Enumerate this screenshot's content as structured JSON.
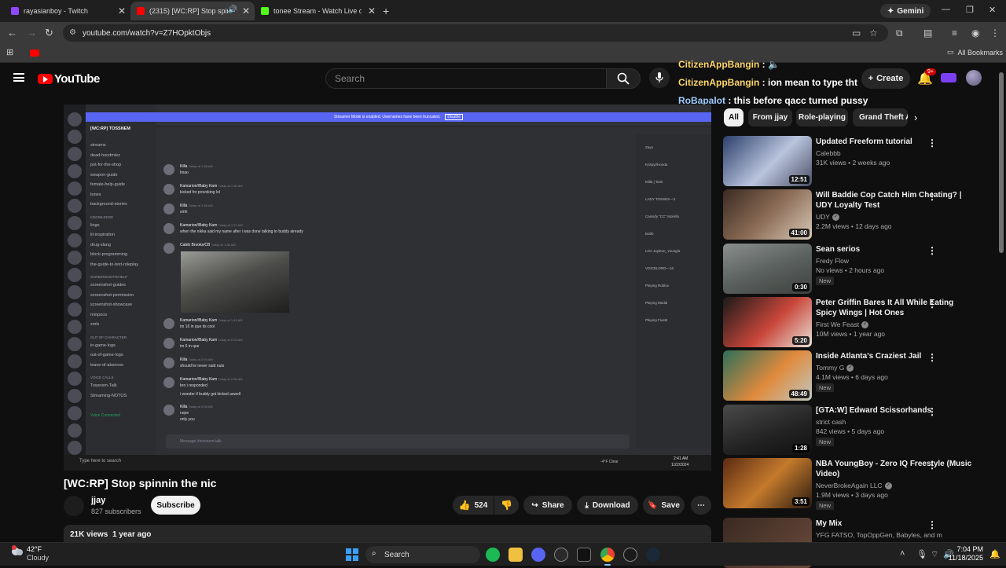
{
  "browser": {
    "tabs": [
      {
        "title": "rayasianboy - Twitch",
        "favicon_color": "#9146ff"
      },
      {
        "title": "(2315) [WC:RP] Stop spinnin",
        "favicon_color": "#ff0000"
      },
      {
        "title": "tonee Stream - Watch Live on K",
        "favicon_color": "#53fc18"
      }
    ],
    "gemini_label": "Gemini",
    "url": "youtube.com/watch?v=Z7HOpktObjs",
    "all_bookmarks": "All Bookmarks"
  },
  "youtube": {
    "logo_text": "YouTube",
    "search_placeholder": "Search",
    "create_label": "Create",
    "notif_count": "9+"
  },
  "chat_overlay": [
    {
      "name": "CitizenAppBangin",
      "text": "",
      "color": "#ffd76a"
    },
    {
      "name": "CitizenAppBangin",
      "text": "ion mean to type tht",
      "color": "#ffd76a"
    },
    {
      "name": "RoBapalot",
      "text": "this before qacc turned pussy",
      "color": "#9ecbff"
    }
  ],
  "video_content": {
    "banner": "Streamer Mode is enabled. Usernames have been truncated.",
    "banner_btn": "Disable",
    "server": "[WC:RP] TOSSNEM",
    "channel": "tossnem-talk",
    "channels_top": [
      "streams",
      "dead-hoodmiez",
      "pot-for-the-shop",
      "weapon-guide",
      "female-help-guide",
      "tones",
      "background-stories"
    ],
    "cat_knowledge": "KNOWLEDGE",
    "channels_knowledge": [
      "lingo",
      "lit-inspiration",
      "drug-slang",
      "block-programming",
      "the-guide-to-text-roleplay"
    ],
    "cat_screenshots": "SCREENSHOTS/HELP",
    "channels_screenshots": [
      "screenshot-guides",
      "screenshot-permission",
      "screenshot-showcase",
      "mmpoos",
      "xmls"
    ],
    "cat_ooc": "OUT OF CHARACTER",
    "channels_ooc": [
      "in-game-logs",
      "out-of-game-logs",
      "leave-of-absense"
    ],
    "cat_voice": "VOICE CALLS",
    "channels_voice": [
      "Tossnem-Talk",
      "Streaming-NOTOS"
    ],
    "voice_status": "Voice Connected",
    "messages": [
      {
        "user": "Killa",
        "time": "Today at 1:36 AM",
        "text": "lmao"
      },
      {
        "user": "Kamarion//Baby Kam",
        "time": "Today at 1:36 AM",
        "text": "kicked for provoking lol"
      },
      {
        "user": "Killa",
        "time": "Today at 1:36 AM",
        "text": "smh"
      },
      {
        "user": "Kamarion//Baby Kam",
        "time": "Today at 1:37 AM",
        "text": "when the nikka said my name after i was done talking to buddy already"
      },
      {
        "user": "Caleb Brooks/CB",
        "time": "Today at 1:38 AM",
        "text": ""
      },
      {
        "user": "Kamarion//Baby Kam",
        "time": "Today at 1:43 AM",
        "text": "im 16 in que its cool"
      },
      {
        "user": "Kamarion//Baby Kam",
        "time": "Today at 2:03 AM",
        "text": "im 6 in que"
      },
      {
        "user": "Killa",
        "time": "Today at 2:04 AM",
        "text": "should've never said nuts"
      },
      {
        "user": "Kamarion//Baby Kam",
        "time": "Today at 2:06 AM",
        "text": "bro i responded"
      },
      {
        "user": "",
        "time": "",
        "text": "i wonder if buddy got kicked aswell"
      },
      {
        "user": "Killa",
        "time": "Today at 2:06 AM",
        "text": "nope"
      },
      {
        "user": "",
        "time": "",
        "text": "only you"
      }
    ],
    "input_placeholder": "Message #tossnem-talk",
    "members": [
      "Zayo",
      "Krispy//Honda",
      "Milla | Tank",
      "LADY TOSSES—3",
      "Cassidy \"CC\" Morello",
      "Bobb",
      "LOA Jayleen_Young/a",
      "VOICELORD—16",
      "Playing Roblox",
      "Playing Medal",
      "Playing FiveM"
    ],
    "taskbar_search": "Type here to search",
    "sys_temp": "-4°F Clear",
    "sys_time": "2:41 AM",
    "sys_date": "1/22/2024"
  },
  "video": {
    "title": "[WC:RP] Stop spinnin the nic",
    "channel": "jjay",
    "subscribers": "827 subscribers",
    "subscribe_label": "Subscribe",
    "likes": "524",
    "share_label": "Share",
    "download_label": "Download",
    "save_label": "Save",
    "views": "21K views",
    "age": "1 year ago"
  },
  "chips": [
    "All",
    "From jjay",
    "Role-playing",
    "Grand Theft A"
  ],
  "recommendations": [
    {
      "title": "Updated Freeform tutorial",
      "channel": "Calebbb",
      "verified": false,
      "views": "31K views",
      "age": "2 weeks ago",
      "duration": "12:51",
      "new": false,
      "thumb": "linear-gradient(135deg,#2b3f6b,#b9c4dd 55%,#4b4f66)"
    },
    {
      "title": "Will Baddie Cop Catch Him Cheating? | UDY Loyalty Test",
      "channel": "UDY",
      "verified": true,
      "views": "2.2M views",
      "age": "12 days ago",
      "duration": "41:00",
      "new": false,
      "thumb": "linear-gradient(135deg,#3a2a22,#8a6b55 50%,#d8c9b8)"
    },
    {
      "title": "Sean serios",
      "channel": "Fredy Flow",
      "verified": false,
      "views": "No views",
      "age": "2 hours ago",
      "duration": "0:30",
      "new": true,
      "thumb": "linear-gradient(160deg,#8a8f8d,#5c625f 50%,#3c403e)"
    },
    {
      "title": "Peter Griffin Bares It All While Eating Spicy Wings | Hot Ones",
      "channel": "First We Feast",
      "verified": true,
      "views": "10M views",
      "age": "1 year ago",
      "duration": "5:20",
      "new": false,
      "thumb": "linear-gradient(135deg,#1a1a1a,#c9463a 55%,#e9e2d8)"
    },
    {
      "title": "Inside Atlanta's Craziest Jail",
      "channel": "Tommy G",
      "verified": true,
      "views": "4.1M views",
      "age": "6 days ago",
      "duration": "48:49",
      "new": true,
      "thumb": "linear-gradient(135deg,#2d6f5a,#e08a3c 55%,#bfc8c2)"
    },
    {
      "title": "[GTA:W] Edward Scissorhands",
      "channel": "strict cash",
      "verified": false,
      "views": "842 views",
      "age": "5 days ago",
      "duration": "1:28",
      "new": true,
      "thumb": "linear-gradient(160deg,#4a4a4a,#222 60%,#111)"
    },
    {
      "title": "NBA YoungBoy - Zero IQ Freestyle (Music Video)",
      "channel": "NeverBrokeAgain LLC",
      "verified": true,
      "views": "1.9M views",
      "age": "3 days ago",
      "duration": "3:51",
      "new": true,
      "thumb": "linear-gradient(135deg,#5b2a12,#c47a2c 50%,#2a1a10)"
    },
    {
      "title": "My Mix",
      "channel": "YFG FATSO, TopOppGen, Babyles, and m",
      "verified": false,
      "views": "",
      "age": "",
      "duration": "",
      "new": false,
      "thumb": "linear-gradient(135deg,#3a2a22,#6a4a3a)"
    }
  ],
  "taskbar": {
    "temperature": "42°F",
    "condition": "Cloudy",
    "search_label": "Search",
    "time": "7:04 PM",
    "date": "11/18/2025"
  }
}
